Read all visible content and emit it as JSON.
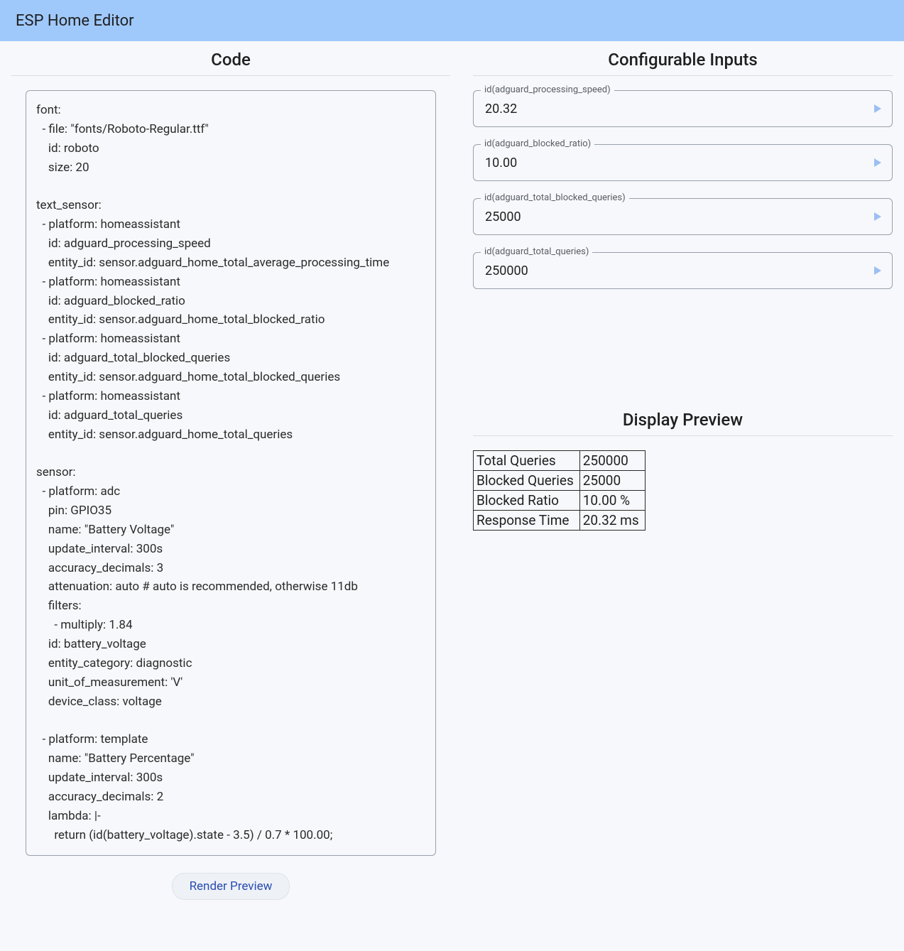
{
  "appbar": {
    "title": "ESP Home Editor"
  },
  "left": {
    "title": "Code",
    "code": "font:\n  - file: \"fonts/Roboto-Regular.ttf\"\n    id: roboto\n    size: 20\n\ntext_sensor:\n  - platform: homeassistant\n    id: adguard_processing_speed\n    entity_id: sensor.adguard_home_total_average_processing_time\n  - platform: homeassistant\n    id: adguard_blocked_ratio\n    entity_id: sensor.adguard_home_total_blocked_ratio\n  - platform: homeassistant\n    id: adguard_total_blocked_queries\n    entity_id: sensor.adguard_home_total_blocked_queries\n  - platform: homeassistant\n    id: adguard_total_queries\n    entity_id: sensor.adguard_home_total_queries\n\nsensor:\n  - platform: adc\n    pin: GPIO35\n    name: \"Battery Voltage\"\n    update_interval: 300s\n    accuracy_decimals: 3\n    attenuation: auto # auto is recommended, otherwise 11db\n    filters:\n      - multiply: 1.84\n    id: battery_voltage\n    entity_category: diagnostic\n    unit_of_measurement: 'V'\n    device_class: voltage\n\n  - platform: template\n    name: \"Battery Percentage\"\n    update_interval: 300s\n    accuracy_decimals: 2\n    lambda: |-\n      return (id(battery_voltage).state - 3.5) / 0.7 * 100.00;",
    "render_button": "Render Preview"
  },
  "right": {
    "inputs_title": "Configurable Inputs",
    "inputs": [
      {
        "label": "id(adguard_processing_speed)",
        "value": "20.32"
      },
      {
        "label": "id(adguard_blocked_ratio)",
        "value": "10.00"
      },
      {
        "label": "id(adguard_total_blocked_queries)",
        "value": "25000"
      },
      {
        "label": "id(adguard_total_queries)",
        "value": "250000"
      }
    ],
    "preview_title": "Display Preview",
    "preview_rows": [
      {
        "k": "Total Queries",
        "v": "250000"
      },
      {
        "k": "Blocked Queries",
        "v": "25000"
      },
      {
        "k": "Blocked Ratio",
        "v": "10.00 %"
      },
      {
        "k": "Response Time",
        "v": "20.32 ms"
      }
    ]
  }
}
